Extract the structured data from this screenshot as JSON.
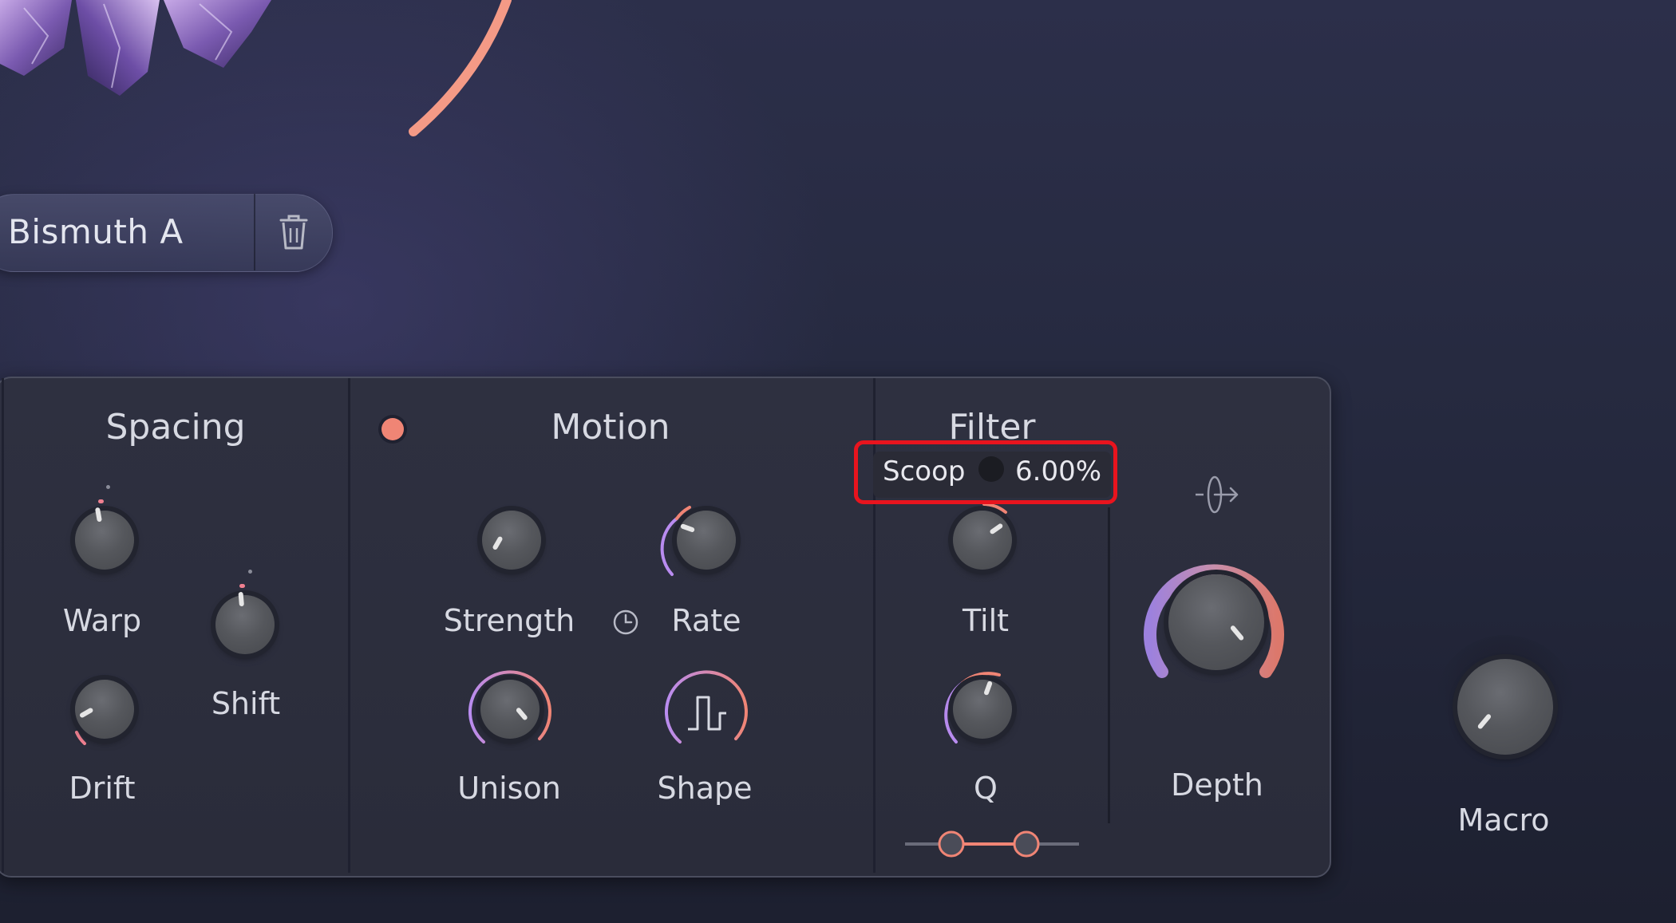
{
  "preset": {
    "name": "Bismuth A"
  },
  "sections": {
    "spacing": {
      "title": "Spacing",
      "knobs": {
        "warp": "Warp",
        "shift": "Shift",
        "drift": "Drift"
      }
    },
    "motion": {
      "title": "Motion",
      "knobs": {
        "strength": "Strength",
        "rate": "Rate",
        "unison": "Unison",
        "shape": "Shape"
      }
    },
    "filter": {
      "title": "Filter",
      "knobs": {
        "tilt": "Tilt",
        "q": "Q"
      }
    },
    "depth": {
      "label": "Depth"
    },
    "macro": {
      "label": "Macro"
    }
  },
  "tooltip": {
    "name": "Scoop",
    "value": "6.00%"
  },
  "colors": {
    "accent_coral": "#f08575",
    "accent_purple": "#b98cf0",
    "highlight": "#e8141e"
  },
  "icons": [
    "crystal-art",
    "trash-icon",
    "clock-icon",
    "square-wave-icon",
    "stereo-arrow-icon",
    "record-dot"
  ]
}
